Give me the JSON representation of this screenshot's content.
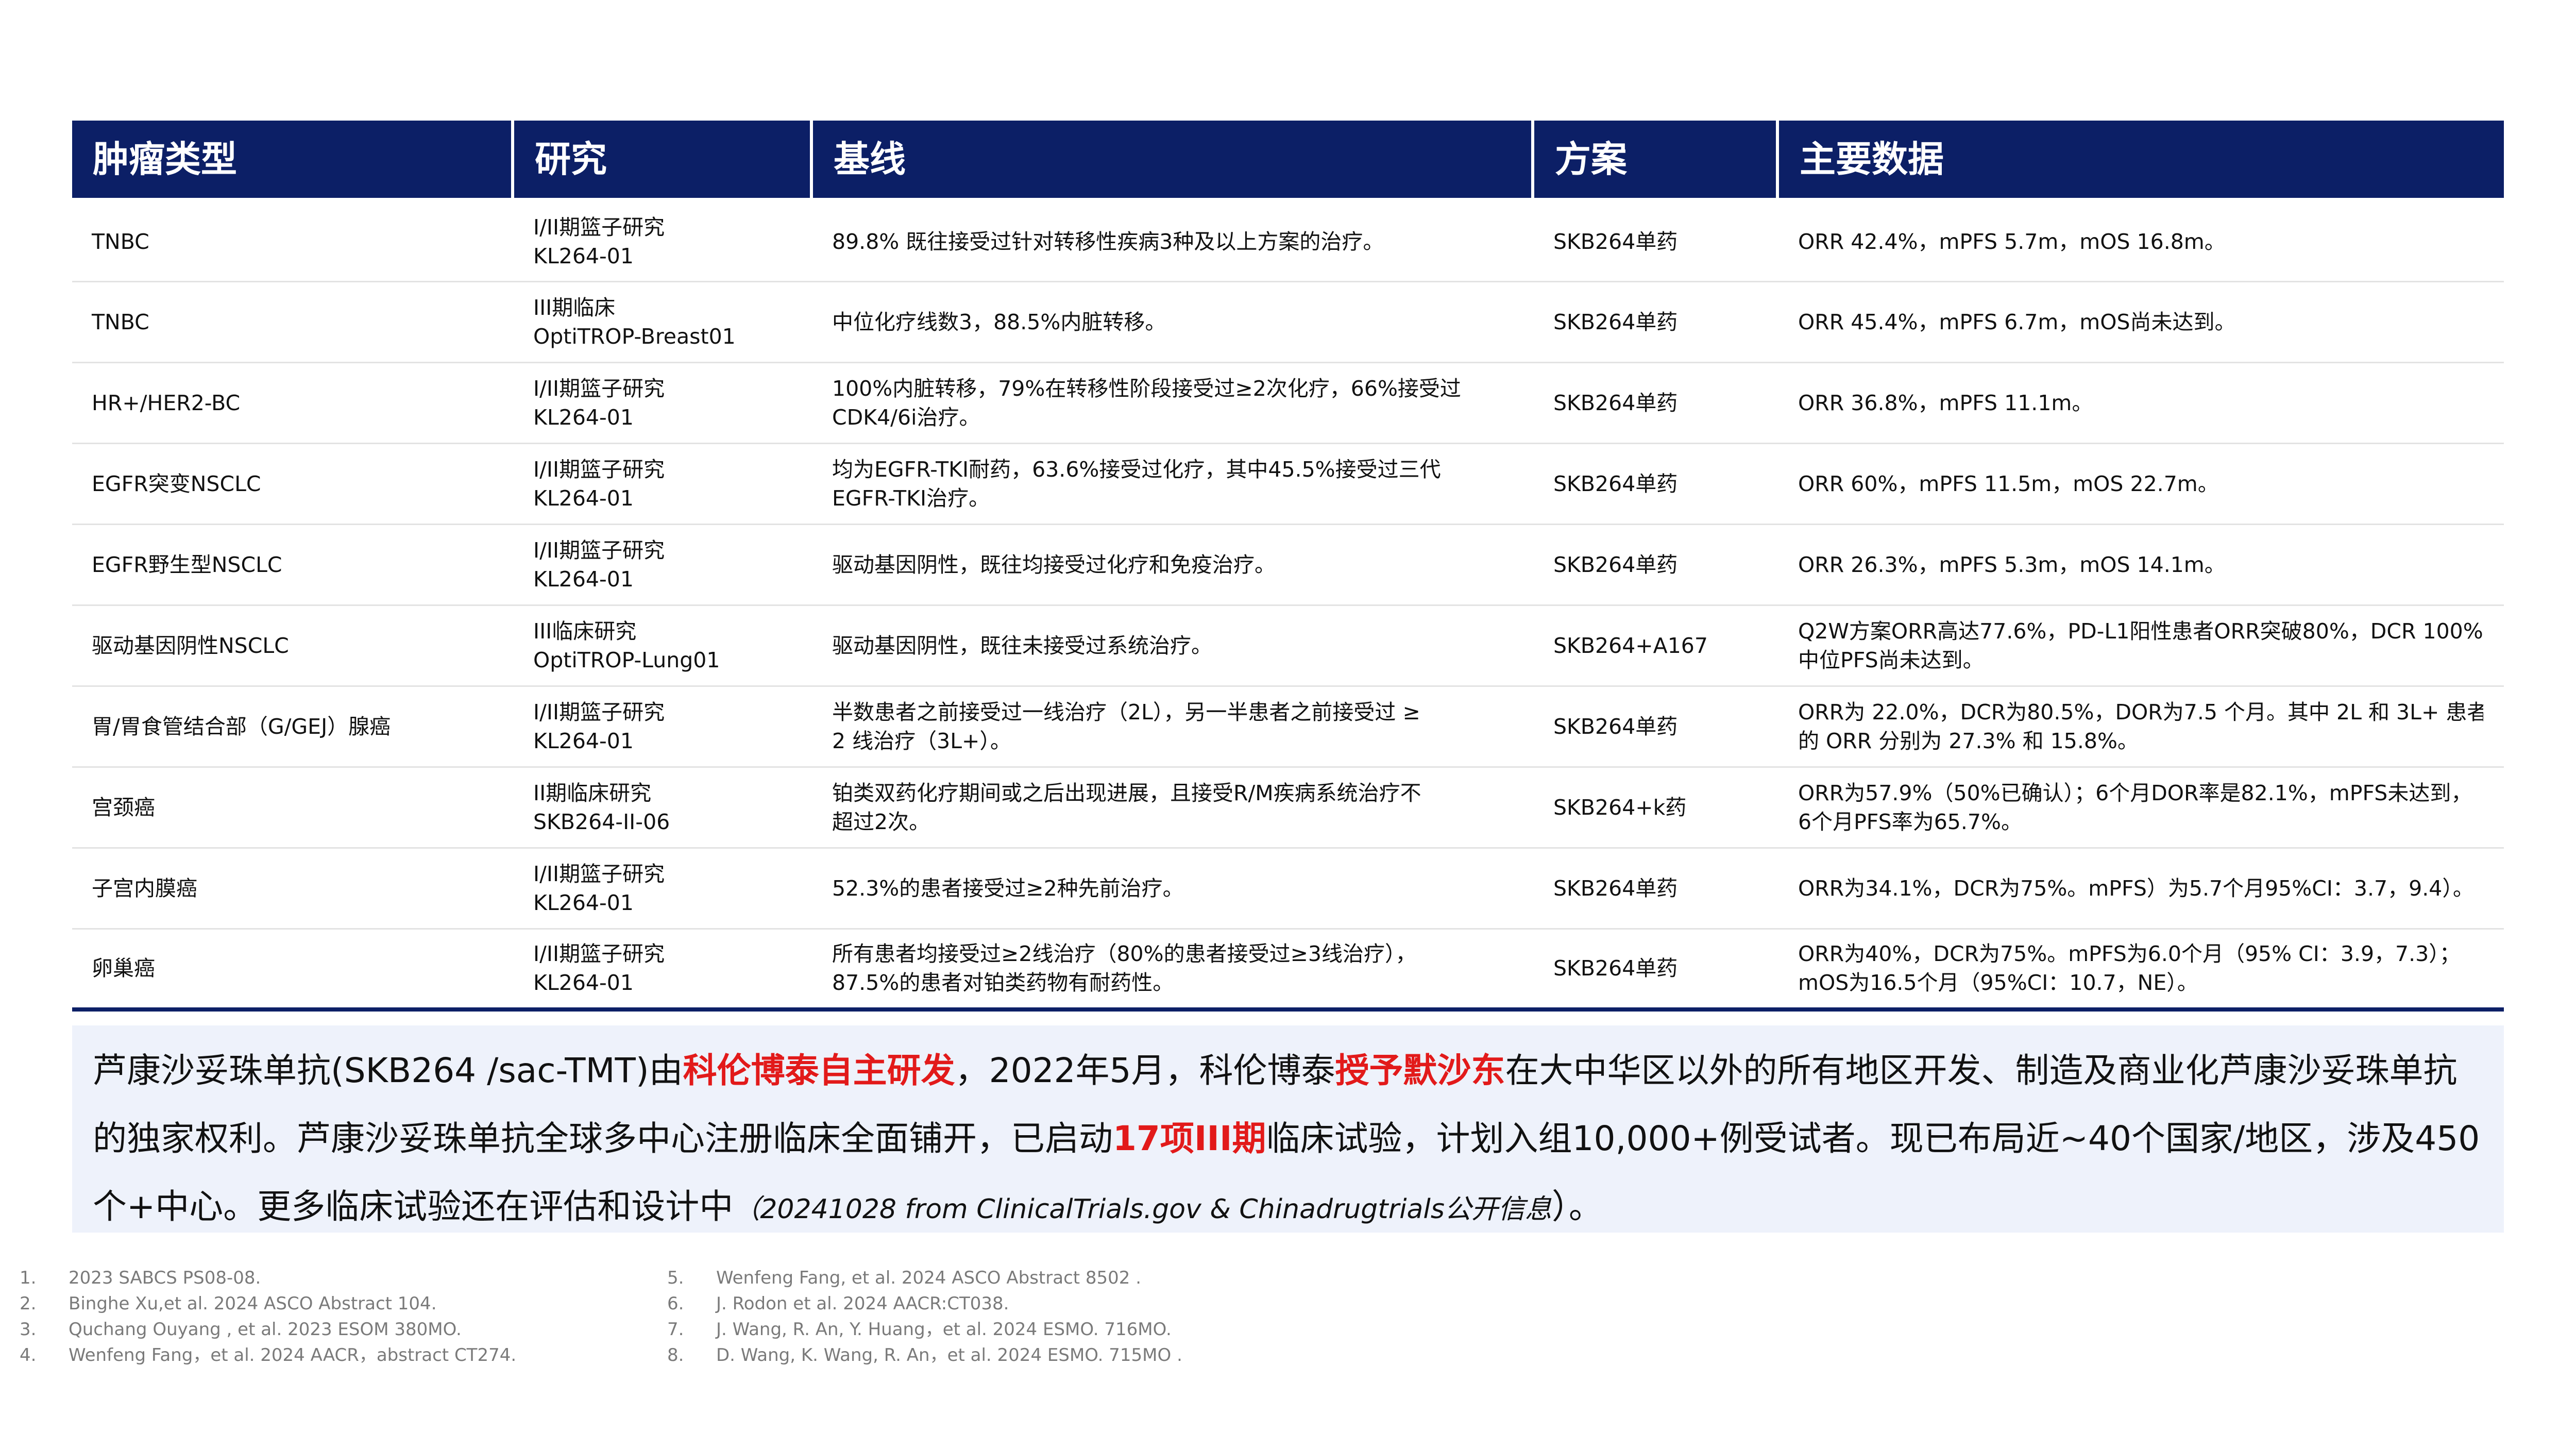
{
  "table": {
    "headers": [
      "肿瘤类型",
      "研究",
      "基线",
      "方案",
      "主要数据"
    ],
    "rows": [
      {
        "tumor": "TNBC",
        "study_l1": "I/II期篮子研究",
        "study_l2": "KL264-01",
        "baseline_l1": "89.8% 既往接受过针对转移性疾病3种及以上方案的治疗。",
        "baseline_l2": "",
        "regimen": "SKB264单药",
        "data_l1": "ORR 42.4%，mPFS 5.7m，mOS 16.8m。",
        "data_l2": ""
      },
      {
        "tumor": "TNBC",
        "study_l1": "III期临床",
        "study_l2": "OptiTROP-Breast01",
        "baseline_l1": "中位化疗线数3，88.5%内脏转移。",
        "baseline_l2": "",
        "regimen": "SKB264单药",
        "data_l1": "ORR 45.4%，mPFS 6.7m，mOS尚未达到。",
        "data_l2": ""
      },
      {
        "tumor": "HR+/HER2-BC",
        "study_l1": "I/II期篮子研究",
        "study_l2": "KL264-01",
        "baseline_l1": "100%内脏转移，79%在转移性阶段接受过≥2次化疗，66%接受过",
        "baseline_l2": "CDK4/6i治疗。",
        "regimen": "SKB264单药",
        "data_l1": "ORR 36.8%，mPFS 11.1m。",
        "data_l2": ""
      },
      {
        "tumor": "EGFR突变NSCLC",
        "study_l1": "I/II期篮子研究",
        "study_l2": "KL264-01",
        "baseline_l1": "均为EGFR-TKI耐药，63.6%接受过化疗，其中45.5%接受过三代",
        "baseline_l2": "EGFR-TKI治疗。",
        "regimen": "SKB264单药",
        "data_l1": "ORR 60%，mPFS 11.5m，mOS 22.7m。",
        "data_l2": ""
      },
      {
        "tumor": "EGFR野生型NSCLC",
        "study_l1": "I/II期篮子研究",
        "study_l2": "KL264-01",
        "baseline_l1": "驱动基因阴性，既往均接受过化疗和免疫治疗。",
        "baseline_l2": "",
        "regimen": "SKB264单药",
        "data_l1": "ORR 26.3%，mPFS 5.3m，mOS 14.1m。",
        "data_l2": ""
      },
      {
        "tumor": "驱动基因阴性NSCLC",
        "study_l1": "III临床研究",
        "study_l2": "OptiTROP-Lung01",
        "baseline_l1": "驱动基因阴性，既往未接受过系统治疗。",
        "baseline_l2": "",
        "regimen": "SKB264+A167",
        "data_l1": "Q2W方案ORR高达77.6%，PD-L1阳性患者ORR突破80%，DCR 100%；",
        "data_l2": "中位PFS尚未达到。"
      },
      {
        "tumor": "胃/胃食管结合部（G/GEJ）腺癌",
        "study_l1": "I/II期篮子研究",
        "study_l2": "KL264-01",
        "baseline_l1": "半数患者之前接受过一线治疗（2L），另一半患者之前接受过 ≥",
        "baseline_l2": "2 线治疗（3L+）。",
        "regimen": "SKB264单药",
        "data_l1": "ORR为 22.0%，DCR为80.5%，DOR为7.5 个月。其中 2L 和 3L+ 患者",
        "data_l2": "的 ORR 分别为 27.3% 和 15.8%。"
      },
      {
        "tumor": "宫颈癌",
        "study_l1": "II期临床研究",
        "study_l2": "SKB264-II-06",
        "baseline_l1": "铂类双药化疗期间或之后出现进展，且接受R/M疾病系统治疗不",
        "baseline_l2": "超过2次。",
        "regimen": "SKB264+k药",
        "data_l1": "ORR为57.9%（50%已确认）；6个月DOR率是82.1%，mPFS未达到，",
        "data_l2": "6个月PFS率为65.7%。"
      },
      {
        "tumor": "子宫内膜癌",
        "study_l1": "I/II期篮子研究",
        "study_l2": "KL264-01",
        "baseline_l1": "52.3%的患者接受过≥2种先前治疗。",
        "baseline_l2": "",
        "regimen": "SKB264单药",
        "data_l1": "ORR为34.1%，DCR为75%。mPFS）为5.7个月95%CI：3.7，9.4）。",
        "data_l2": ""
      },
      {
        "tumor": "卵巢癌",
        "study_l1": "I/II期篮子研究",
        "study_l2": "KL264-01",
        "baseline_l1": "所有患者均接受过≥2线治疗（80%的患者接受过≥3线治疗），",
        "baseline_l2": "87.5%的患者对铂类药物有耐药性。",
        "regimen": "SKB264单药",
        "data_l1": "ORR为40%，DCR为75%。mPFS为6.0个月（95% CI：3.9，7.3）；",
        "data_l2": "mOS为16.5个月（95%CI：10.7，NE）。"
      }
    ]
  },
  "summary": {
    "p1": "芦康沙妥珠单抗(SKB264 /sac-TMT)由",
    "h1": "科伦博泰自主研发",
    "p2": "，2022年5月，科伦博泰",
    "h2": "授予默沙东",
    "p3": "在大中华区以外的所有地区开发、制造及商业化芦康沙妥珠单抗的独家权利。芦康沙妥珠单抗全球多中心注册临床全面铺开，已启动",
    "h3": "17项III期",
    "p4": "临床试验，计划入组10,000+例受试者。现已布局近~40个国家/地区，涉及450个+中心。更多临床试验还在评估和设计中",
    "src_open": "（",
    "source": "20241028 from ClinicalTrials.gov & Chinadrugtrials公开信息",
    "src_close": "）。"
  },
  "references": {
    "left": [
      {
        "num": "1.",
        "text": "2023 SABCS PS08-08."
      },
      {
        "num": "2.",
        "text": "Binghe Xu,et al. 2024 ASCO Abstract 104."
      },
      {
        "num": "3.",
        "text": "Quchang Ouyang , et al. 2023 ESOM 380MO."
      },
      {
        "num": "4.",
        "text": "Wenfeng Fang，et al. 2024 AACR，abstract CT274."
      }
    ],
    "right": [
      {
        "num": "5.",
        "text": "Wenfeng Fang, et al. 2024 ASCO Abstract 8502 ."
      },
      {
        "num": "6.",
        "text": "J. Rodon et al. 2024 AACR:CT038."
      },
      {
        "num": "7.",
        "text": "J. Wang, R. An, Y. Huang，et al. 2024 ESMO. 716MO."
      },
      {
        "num": "8.",
        "text": "D. Wang, K. Wang, R. An，et al. 2024 ESMO. 715MO ."
      }
    ]
  },
  "colors": {
    "header_bg": "#0c1f66",
    "highlight": "#e21a1a",
    "summary_bg": "#eef2fb",
    "reference_text": "#7a7a7a"
  }
}
